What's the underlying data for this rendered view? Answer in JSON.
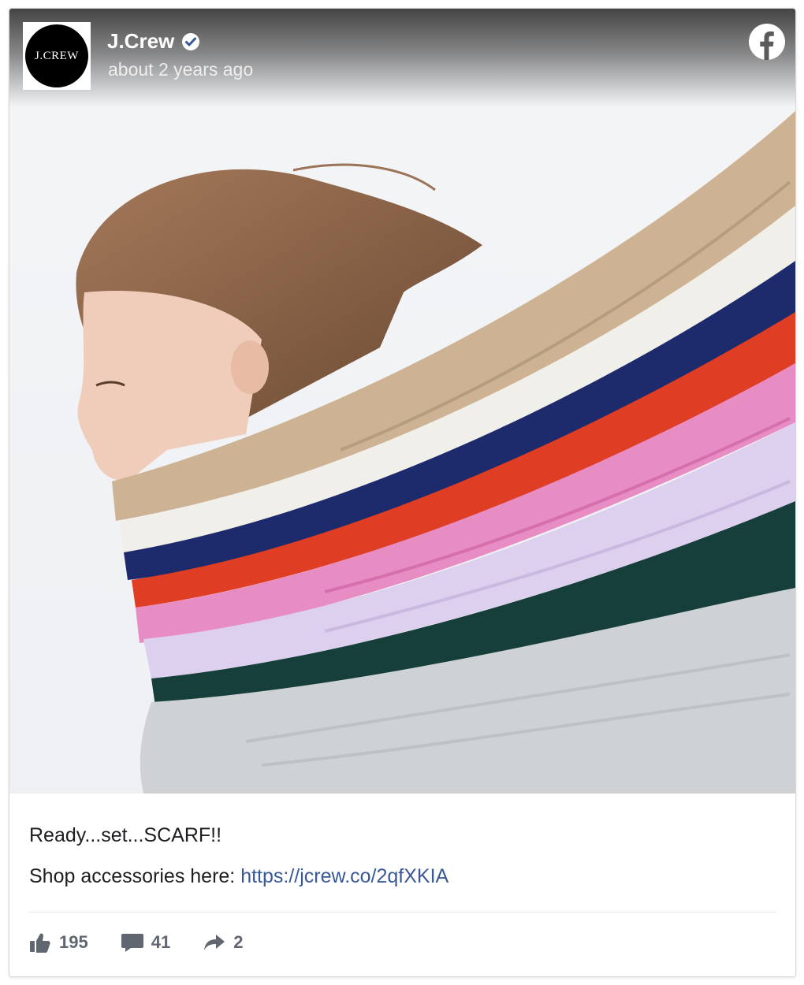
{
  "post": {
    "page_name": "J.Crew",
    "avatar_text": "J.CREW",
    "timestamp": "about 2 years ago",
    "caption": "Ready...set...SCARF!!",
    "shop_prefix": "Shop accessories here: ",
    "shop_link": "https://jcrew.co/2qfXKIA",
    "photo_alt": "Model with face wrapped in stack of colorful cable-knit scarves"
  },
  "stats": {
    "likes": "195",
    "comments": "41",
    "shares": "2"
  },
  "icons": {
    "verified": "verified-badge-icon",
    "platform": "facebook-icon",
    "like": "thumbs-up-icon",
    "comment": "comment-icon",
    "share": "share-arrow-icon"
  },
  "colors": {
    "link": "#385898",
    "stat_text": "#606770",
    "scarf_palette": [
      "#cdb293",
      "#f1efea",
      "#1d2a6b",
      "#df3d24",
      "#e88cc4",
      "#ddd0ef",
      "#163e3a",
      "#cfd2d5"
    ]
  }
}
